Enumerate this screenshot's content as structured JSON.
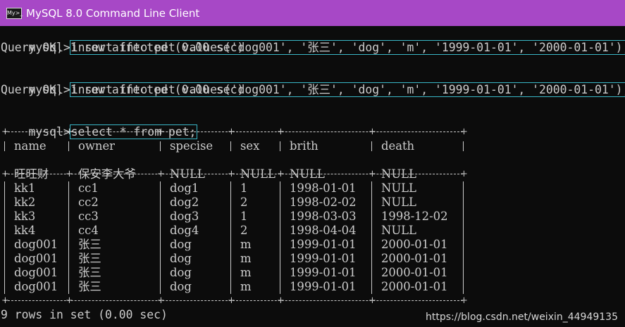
{
  "window": {
    "icon_label": "My>_",
    "title": "MySQL 8.0 Command Line Client"
  },
  "console": {
    "prompt": "mysql>",
    "commands": [
      "insert into pet values('dog001', '张三', 'dog', 'm', '1999-01-01', '2000-01-01');",
      "insert into pet values('dog001', '张三', 'dog', 'm', '1999-01-01', '2000-01-01');",
      "select * from pet;"
    ],
    "results": [
      "Query OK, 1 row affected (0.00 sec)",
      "Query OK, 1 row affected (0.00 sec)",
      "9 rows in set (0.00 sec)"
    ],
    "table": {
      "separator": "+-------+--------+--------+-----+------------+------------+",
      "columns": [
        "name",
        "owner",
        "specise",
        "sex",
        "brith",
        "death"
      ],
      "rows": [
        [
          "旺旺财",
          "保安李大爷",
          "NULL",
          "NULL",
          "NULL",
          "NULL"
        ],
        [
          "kk1",
          "cc1",
          "dog1",
          "1",
          "1998-01-01",
          "NULL"
        ],
        [
          "kk2",
          "cc2",
          "dog2",
          "2",
          "1998-02-02",
          "NULL"
        ],
        [
          "kk3",
          "cc3",
          "dog3",
          "1",
          "1998-03-03",
          "1998-12-02"
        ],
        [
          "kk4",
          "cc4",
          "dog4",
          "2",
          "1998-04-04",
          "NULL"
        ],
        [
          "dog001",
          "张三",
          "dog",
          "m",
          "1999-01-01",
          "2000-01-01"
        ],
        [
          "dog001",
          "张三",
          "dog",
          "m",
          "1999-01-01",
          "2000-01-01"
        ],
        [
          "dog001",
          "张三",
          "dog",
          "m",
          "1999-01-01",
          "2000-01-01"
        ],
        [
          "dog001",
          "张三",
          "dog",
          "m",
          "1999-01-01",
          "2000-01-01"
        ]
      ]
    }
  },
  "watermark": "https://blog.csdn.net/weixin_44949135",
  "colors": {
    "titlebar": "#a748c6",
    "background": "#0c0c0c",
    "text": "#cccccc",
    "selection_outline": "#3ab7c7"
  }
}
